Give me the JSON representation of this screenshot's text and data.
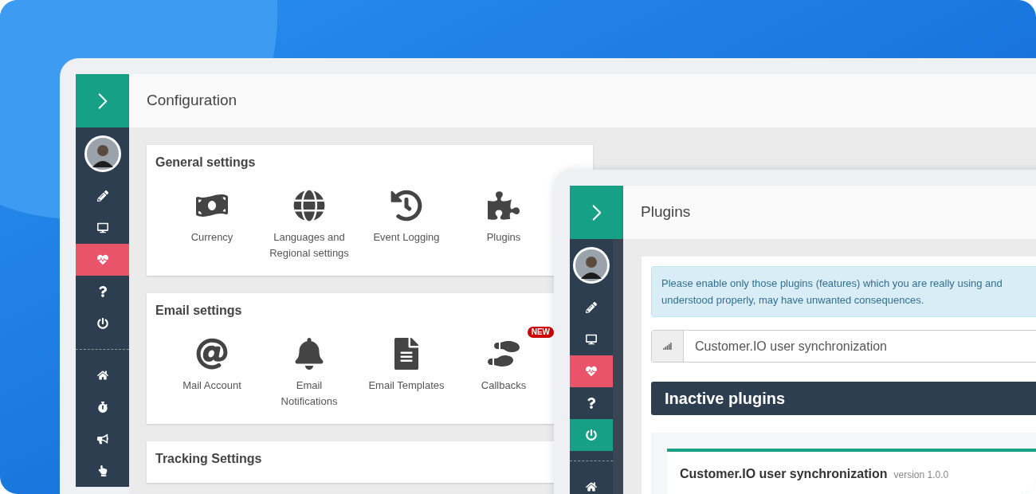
{
  "back_window": {
    "title": "Configuration",
    "sidebar": {
      "top_items": [
        {
          "color": "#2c3e50"
        },
        {
          "color": "#2c3e50"
        },
        {
          "color": "#e9546b"
        },
        {
          "color": "#2c3e50"
        },
        {
          "color": "#2c3e50"
        }
      ],
      "bottom_items": [
        {
          "color": "#2c3e50"
        },
        {
          "color": "#2c3e50"
        },
        {
          "color": "#2c3e50"
        },
        {
          "color": "#2c3e50"
        }
      ]
    },
    "sections": [
      {
        "title": "General settings",
        "items": [
          {
            "label": "Currency"
          },
          {
            "label": "Languages and Regional settings"
          },
          {
            "label": "Event Logging"
          },
          {
            "label": "Plugins"
          }
        ]
      },
      {
        "title": "Email settings",
        "items": [
          {
            "label": "Mail Account"
          },
          {
            "label": "Email Notifications"
          },
          {
            "label": "Email Templates"
          },
          {
            "label": "Callbacks",
            "badge": "NEW"
          }
        ]
      },
      {
        "title": "Tracking Settings"
      }
    ]
  },
  "front_window": {
    "title": "Plugins",
    "sidebar": {
      "top_items": [
        {
          "color": "#2c3e50"
        },
        {
          "color": "#2c3e50"
        },
        {
          "color": "#e9546b"
        },
        {
          "color": "#2c3e50"
        },
        {
          "color": "#16a085"
        }
      ],
      "bottom_items": [
        {
          "color": "#2c3e50"
        }
      ]
    },
    "alert": "Please enable only those plugins (features) which you are really using and understood properly, may have unwanted consequences.",
    "search": {
      "value": "Customer.IO user synchronization"
    },
    "section_heading": "Inactive plugins",
    "plugin": {
      "name": "Customer.IO user synchronization",
      "version": "version 1.0.0"
    }
  }
}
